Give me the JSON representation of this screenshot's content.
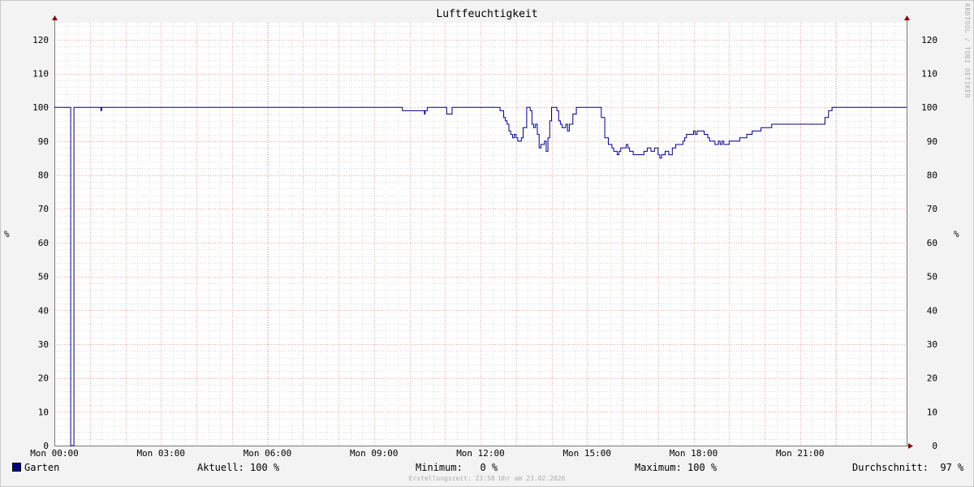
{
  "chart_data": {
    "type": "line",
    "title": "Luftfeuchtigkeit",
    "ylabel": "%",
    "ylim": [
      0,
      125
    ],
    "y_ticks": [
      0,
      10,
      20,
      30,
      40,
      50,
      60,
      70,
      80,
      90,
      100,
      110,
      120
    ],
    "xlim": [
      0,
      24
    ],
    "x_ticks": [
      {
        "hour": 0,
        "label": "Mon 00:00"
      },
      {
        "hour": 3,
        "label": "Mon 03:00"
      },
      {
        "hour": 6,
        "label": "Mon 06:00"
      },
      {
        "hour": 9,
        "label": "Mon 09:00"
      },
      {
        "hour": 12,
        "label": "Mon 12:00"
      },
      {
        "hour": 15,
        "label": "Mon 15:00"
      },
      {
        "hour": 18,
        "label": "Mon 18:00"
      },
      {
        "hour": 21,
        "label": "Mon 21:00"
      }
    ],
    "grid": true,
    "series": [
      {
        "name": "Garten",
        "color": "#00008b",
        "x": [
          0,
          0.45,
          0.46,
          0.53,
          0.55,
          0.6,
          1.3,
          1.31,
          1.33,
          1.34,
          1.4,
          9.8,
          9.82,
          10.4,
          10.42,
          10.44,
          10.46,
          10.5,
          11.0,
          11.05,
          11.15,
          11.2,
          11.3,
          12.5,
          12.55,
          12.65,
          12.7,
          12.75,
          12.8,
          12.85,
          12.9,
          12.95,
          13.0,
          13.05,
          13.1,
          13.15,
          13.2,
          13.3,
          13.35,
          13.4,
          13.45,
          13.5,
          13.55,
          13.6,
          13.65,
          13.7,
          13.8,
          13.85,
          13.9,
          13.95,
          14.0,
          14.05,
          14.1,
          14.15,
          14.2,
          14.25,
          14.3,
          14.4,
          14.45,
          14.5,
          14.6,
          14.7,
          14.75,
          14.8,
          14.85,
          14.9,
          14.95,
          15.0,
          15.05,
          15.1,
          15.15,
          15.2,
          15.3,
          15.4,
          15.5,
          15.6,
          15.7,
          15.75,
          15.8,
          15.85,
          15.9,
          15.95,
          16.0,
          16.05,
          16.1,
          16.15,
          16.2,
          16.25,
          16.3,
          16.35,
          16.4,
          16.5,
          16.6,
          16.7,
          16.8,
          16.9,
          17.0,
          17.05,
          17.1,
          17.2,
          17.3,
          17.4,
          17.5,
          17.6,
          17.7,
          17.75,
          17.8,
          17.9,
          18.0,
          18.05,
          18.1,
          18.2,
          18.3,
          18.4,
          18.45,
          18.5,
          18.6,
          18.7,
          18.75,
          18.8,
          18.85,
          18.9,
          19.0,
          19.1,
          19.2,
          19.3,
          19.35,
          19.4,
          19.5,
          19.55,
          19.6,
          19.65,
          19.7,
          19.8,
          19.9,
          20.0,
          20.1,
          20.2,
          20.3,
          20.35,
          20.4,
          20.5,
          20.6,
          20.7,
          20.8,
          20.9,
          21.0,
          21.1,
          21.2,
          21.3,
          21.4,
          21.5,
          21.6,
          21.7,
          21.8,
          21.9,
          22.0,
          22.1,
          22.2,
          22.3,
          22.35,
          22.4,
          22.45,
          22.5,
          23.0,
          23.5,
          24.0
        ],
        "values": [
          100,
          100,
          0,
          0,
          100,
          100,
          100,
          99,
          100,
          100,
          100,
          99,
          99,
          99,
          98,
          99,
          99,
          100,
          100,
          98,
          98,
          100,
          100,
          100,
          99,
          97,
          96,
          95,
          93,
          92,
          91,
          92,
          91,
          90,
          90,
          91,
          94,
          100,
          100,
          99,
          95,
          94,
          95,
          92,
          88,
          89,
          90,
          87,
          91,
          96,
          100,
          100,
          100,
          99,
          96,
          95,
          94,
          95,
          93,
          95,
          98,
          100,
          100,
          100,
          100,
          100,
          100,
          100,
          100,
          100,
          100,
          100,
          100,
          97,
          91,
          89,
          88,
          87,
          87,
          86,
          87,
          88,
          88,
          88,
          89,
          88,
          87,
          87,
          86,
          86,
          86,
          86,
          87,
          88,
          87,
          88,
          86,
          85,
          86,
          87,
          86,
          88,
          89,
          89,
          90,
          91,
          92,
          92,
          93,
          92,
          93,
          93,
          92,
          91,
          90,
          90,
          89,
          90,
          89,
          90,
          89,
          89,
          90,
          90,
          90,
          91,
          91,
          91,
          92,
          92,
          92,
          93,
          93,
          93,
          94,
          94,
          94,
          95,
          95,
          95,
          95,
          95,
          95,
          95,
          95,
          95,
          95,
          95,
          95,
          95,
          95,
          95,
          95,
          97,
          99,
          100,
          100,
          100,
          100,
          100,
          100,
          100,
          100,
          100,
          100,
          100,
          100
        ]
      }
    ],
    "legend": {
      "series_name": "Garten",
      "aktuell": "Aktuell: 100 %",
      "minimum": "Minimum:   0 %",
      "maximum": "Maximum: 100 %",
      "durchschnitt": "Durchschnitt:  97 %"
    },
    "ylabel_right": "%",
    "watermark": "RRDTOOL / TOBI OETIKER",
    "footer": "Erstellungszeit: 23:58 Uhr am 23.02.2026"
  }
}
